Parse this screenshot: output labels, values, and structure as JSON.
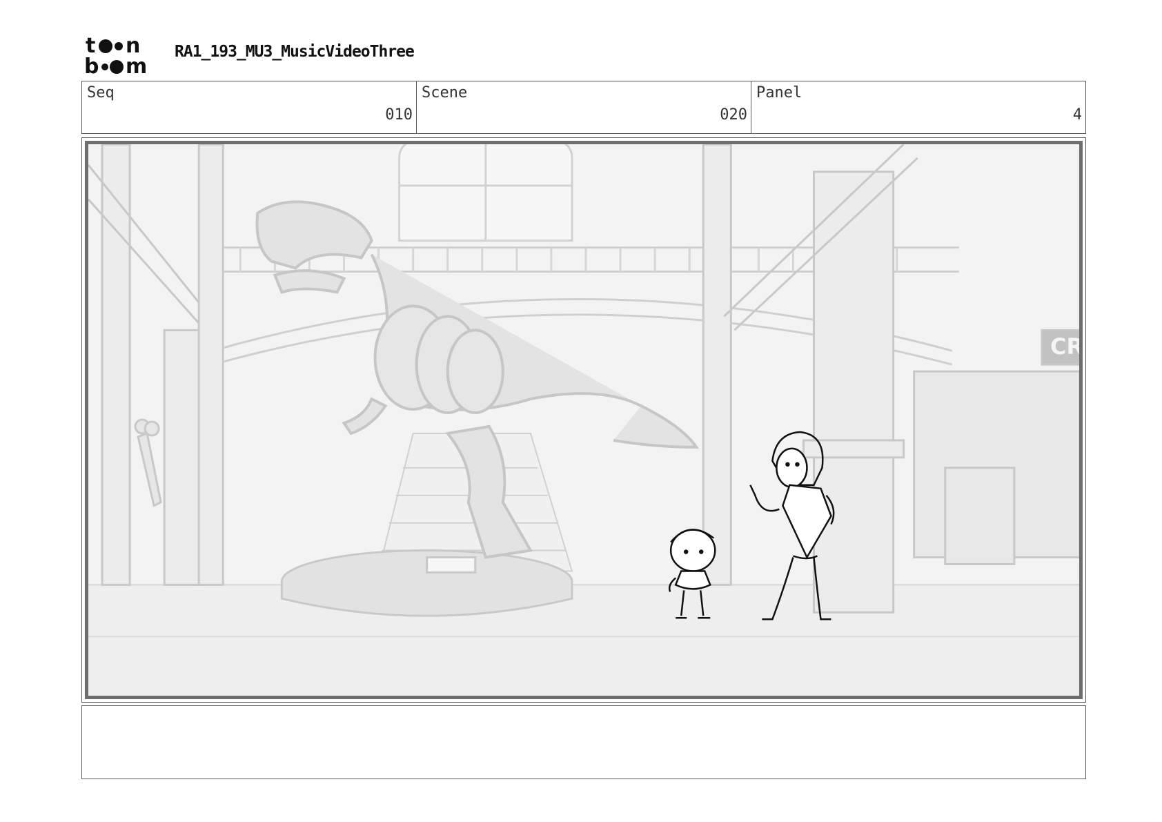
{
  "header": {
    "logo_text": "toon boom",
    "project_title": "RA1_193_MU3_MusicVideoThree"
  },
  "info": {
    "seq_label": "Seq",
    "seq_value": "010",
    "scene_label": "Scene",
    "scene_value": "020",
    "panel_label": "Panel",
    "panel_value": "4"
  },
  "panel": {
    "sign_text": "CR",
    "colors": {
      "background": "#f3f3f3",
      "bg_lines": "#c9c9c9",
      "bg_fill": "#dcdcdc",
      "sketch_lines": "#111111"
    }
  },
  "notes": {
    "text": ""
  }
}
